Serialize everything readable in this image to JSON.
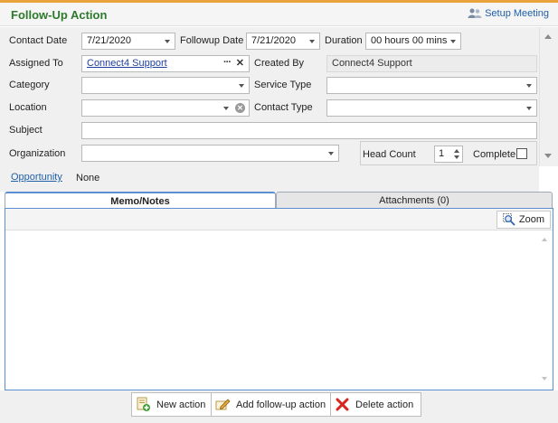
{
  "header": {
    "title": "Follow-Up Action",
    "setup_meeting": "Setup Meeting"
  },
  "form": {
    "contact_date_label": "Contact Date",
    "contact_date_value": "7/21/2020",
    "followup_date_label": "Followup Date",
    "followup_date_value": "7/21/2020",
    "duration_label": "Duration",
    "duration_value": "00 hours 00 mins",
    "assigned_to_label": "Assigned To",
    "assigned_to_value": "Connect4 Support",
    "created_by_label": "Created By",
    "created_by_value": "Connect4 Support",
    "category_label": "Category",
    "category_value": "",
    "service_type_label": "Service Type",
    "service_type_value": "",
    "location_label": "Location",
    "location_value": "",
    "contact_type_label": "Contact Type",
    "contact_type_value": "",
    "subject_label": "Subject",
    "subject_value": "",
    "organization_label": "Organization",
    "organization_value": "",
    "head_count_label": "Head Count",
    "head_count_value": "1",
    "complete_label": "Complete",
    "opportunity_label": "Opportunity",
    "opportunity_value": "None"
  },
  "tabs": [
    {
      "label": "Memo/Notes",
      "active": true
    },
    {
      "label": "Attachments (0)",
      "active": false
    }
  ],
  "memo": {
    "zoom_label": "Zoom",
    "text": ""
  },
  "footer": {
    "new_action": "New action",
    "add_followup": "Add follow-up action",
    "delete_action": "Delete action"
  },
  "colors": {
    "accent_orange": "#e8a33c",
    "title_green": "#2d7a2d",
    "link_blue": "#1f5fa8",
    "tab_border": "#5b8fd1"
  },
  "icons": {
    "setup_meeting": "people-icon",
    "zoom": "magnifier-icon",
    "new_action": "add-document-icon",
    "add_followup": "pencil-edit-icon",
    "delete_action": "red-x-icon"
  }
}
